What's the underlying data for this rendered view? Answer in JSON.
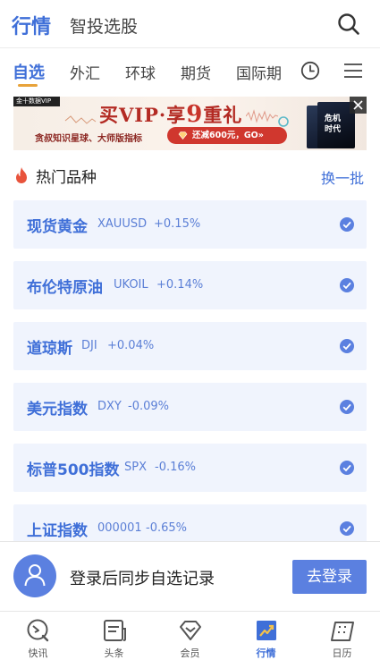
{
  "header": {
    "tabs": [
      {
        "label": "行情",
        "active": true
      },
      {
        "label": "智投选股",
        "active": false
      }
    ],
    "search_icon": "search-icon"
  },
  "subtabs": {
    "items": [
      {
        "label": "自选",
        "active": true
      },
      {
        "label": "外汇",
        "active": false
      },
      {
        "label": "环球",
        "active": false
      },
      {
        "label": "期货",
        "active": false
      },
      {
        "label": "国际期",
        "active": false
      }
    ],
    "clock_icon": "clock-icon",
    "menu_icon": "menu-icon"
  },
  "banner": {
    "logo_text": "金十数据VIP",
    "title_pre": "买VIP·享",
    "title_num": "9",
    "title_post": "重礼",
    "subtitle": "贪叔知识星球、大师版指标",
    "cta": "还减600元，GO»",
    "book_text_1": "危机",
    "book_text_2": "时代"
  },
  "hot": {
    "title": "热门品种",
    "refresh_label": "换一批",
    "items": [
      {
        "name": "现货黄金",
        "code": "XAUUSD",
        "change": "+0.15%",
        "checked": true
      },
      {
        "name": "布伦特原油",
        "code": "UKOIL",
        "change": "+0.14%",
        "checked": true
      },
      {
        "name": "道琼斯",
        "code": "DJI",
        "change": "+0.04%",
        "checked": true
      },
      {
        "name": "美元指数",
        "code": "DXY",
        "change": "-0.09%",
        "checked": true
      },
      {
        "name": "标普500指数",
        "code": "SPX",
        "change": "-0.16%",
        "checked": true
      },
      {
        "name": "上证指数",
        "code": "000001",
        "change": "-0.65%",
        "checked": true
      }
    ]
  },
  "login": {
    "text": "登录后同步自选记录",
    "button": "去登录"
  },
  "bottom_nav": {
    "items": [
      {
        "label": "快讯",
        "icon": "flash-news-icon",
        "active": false
      },
      {
        "label": "头条",
        "icon": "headline-icon",
        "active": false
      },
      {
        "label": "会员",
        "icon": "vip-diamond-icon",
        "active": false
      },
      {
        "label": "行情",
        "icon": "market-chart-icon",
        "active": true
      },
      {
        "label": "日历",
        "icon": "calendar-icon",
        "active": false
      }
    ]
  },
  "colors": {
    "accent": "#3f6fd8",
    "card_bg": "#f0f4fd",
    "underline": "#e8a33a",
    "fire": "#e8533c",
    "banner_red": "#b32a23"
  }
}
